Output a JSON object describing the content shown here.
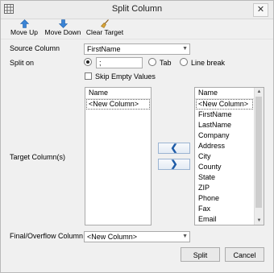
{
  "window": {
    "title": "Split Column",
    "close_glyph": "✕"
  },
  "toolbar": {
    "move_up": "Move Up",
    "move_down": "Move Down",
    "clear_target": "Clear Target"
  },
  "form": {
    "source_label": "Source Column",
    "source_value": "FirstName",
    "split_on_label": "Split on",
    "split_char": ";",
    "tab_label": "Tab",
    "line_break_label": "Line break",
    "skip_empty_label": "Skip Empty Values",
    "target_label": "Target Column(s)",
    "final_label": "Final/Overflow Column",
    "final_value": "<New Column>"
  },
  "target_list": {
    "header": "Name",
    "items": [
      "<New Column>"
    ]
  },
  "source_list": {
    "header": "Name",
    "items": [
      "<New Column>",
      "FirstName",
      "LastName",
      "Company",
      "Address",
      "City",
      "County",
      "State",
      "ZIP",
      "Phone",
      "Fax",
      "Email"
    ]
  },
  "buttons": {
    "move_left": "❮",
    "move_right": "❯",
    "split": "Split",
    "cancel": "Cancel"
  },
  "icons": {
    "app": "grid-icon",
    "up": "arrow-up-icon",
    "down": "arrow-down-icon",
    "clear": "broom-icon"
  },
  "colors": {
    "accent": "#1e6fd9",
    "button_text": "#1e5ca8"
  }
}
